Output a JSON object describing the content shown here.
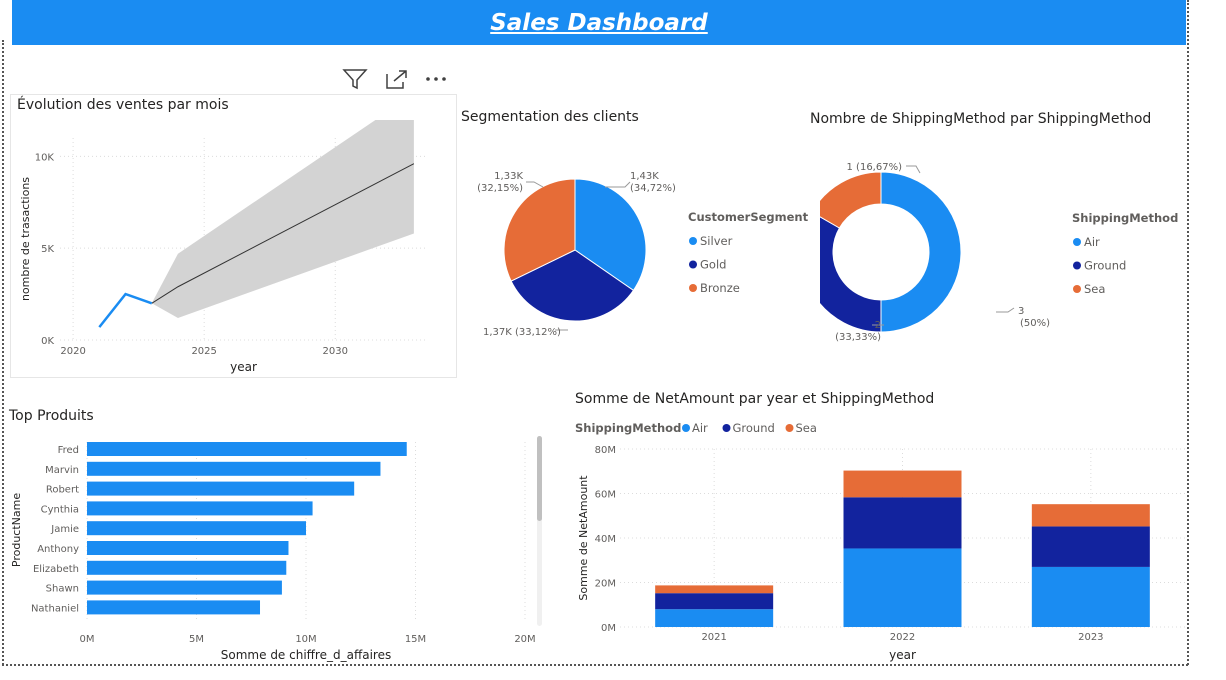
{
  "header": {
    "title": "Sales Dashboard"
  },
  "visual_header": {
    "icons": [
      "filter-icon",
      "focus-mode-icon",
      "more-options-icon"
    ]
  },
  "colors": {
    "primary": "#1a8cf2",
    "dark_blue": "#12239e",
    "orange": "#e66c37",
    "band": "#d3d3d3"
  },
  "chart_data": [
    {
      "id": "sales-evolution",
      "type": "line",
      "title": "Évolution des ventes par mois",
      "xlabel": "year",
      "ylabel": "nombre de trasactions",
      "x_ticks": [
        "2020",
        "2025",
        "2030"
      ],
      "y_ticks": [
        "0K",
        "5K",
        "10K"
      ],
      "xlim": [
        2019.5,
        2033.5
      ],
      "ylim": [
        0,
        11000
      ],
      "grid": true,
      "series": [
        {
          "kind": "actual",
          "x": [
            2021,
            2022,
            2023
          ],
          "y": [
            700,
            2500,
            2000
          ]
        },
        {
          "kind": "forecast",
          "x": [
            2023,
            2024,
            2033
          ],
          "y": [
            2000,
            2900,
            9600
          ]
        },
        {
          "kind": "confidence-band",
          "x": [
            2023,
            2024,
            2033
          ],
          "upper": [
            2000,
            4700,
            13400
          ],
          "lower": [
            2000,
            1200,
            5800
          ]
        }
      ]
    },
    {
      "id": "customer-segmentation",
      "type": "pie",
      "title": "Segmentation des clients",
      "legend_title": "CustomerSegment",
      "legend_position": "right",
      "slices": [
        {
          "label": "Silver",
          "value": 1430,
          "percent": 34.72,
          "display": "1,43K",
          "percent_display": "(34,72%)",
          "color": "#1a8cf2"
        },
        {
          "label": "Gold",
          "value": 1370,
          "percent": 33.12,
          "display": "1,37K (33,12%)",
          "color": "#12239e"
        },
        {
          "label": "Bronze",
          "value": 1330,
          "percent": 32.15,
          "display": "1,33K",
          "percent_display": "(32,15%)",
          "color": "#e66c37"
        }
      ]
    },
    {
      "id": "shipping-count",
      "type": "pie",
      "subtype": "donut",
      "title": "Nombre de ShippingMethod par ShippingMethod",
      "legend_title": "ShippingMethod",
      "legend_position": "right",
      "slices": [
        {
          "label": "Air",
          "value": 3,
          "percent": 50,
          "display": "3",
          "percent_display": "(50%)",
          "color": "#1a8cf2"
        },
        {
          "label": "Ground",
          "value": 2,
          "percent": 33.33,
          "display": "2",
          "percent_display": "(33,33%)",
          "color": "#12239e"
        },
        {
          "label": "Sea",
          "value": 1,
          "percent": 16.67,
          "display": "1 (16,67%)",
          "color": "#e66c37"
        }
      ]
    },
    {
      "id": "top-products",
      "type": "bar",
      "orientation": "horizontal",
      "title": "Top Produits",
      "xlabel": "Somme de chiffre_d_affaires",
      "ylabel": "ProductName",
      "x_ticks": [
        "0M",
        "5M",
        "10M",
        "15M",
        "20M"
      ],
      "xlim": [
        0,
        20000000
      ],
      "categories": [
        "Fred",
        "Marvin",
        "Robert",
        "Cynthia",
        "Jamie",
        "Anthony",
        "Elizabeth",
        "Shawn",
        "Nathaniel"
      ],
      "values": [
        14600000,
        13400000,
        12200000,
        10300000,
        10000000,
        9200000,
        9100000,
        8900000,
        7900000
      ]
    },
    {
      "id": "netamount-by-year",
      "type": "bar",
      "stacked": true,
      "title": "Somme de NetAmount par year et ShippingMethod",
      "legend_title": "ShippingMethod",
      "legend_position": "top-left",
      "xlabel": "year",
      "ylabel": "Somme de NetAmount",
      "y_ticks": [
        "0M",
        "20M",
        "40M",
        "60M",
        "80M"
      ],
      "ylim": [
        0,
        80000000
      ],
      "categories": [
        "2021",
        "2022",
        "2023"
      ],
      "series": [
        {
          "name": "Air",
          "color": "#1a8cf2",
          "values": [
            8000000,
            35300000,
            27000000
          ]
        },
        {
          "name": "Ground",
          "color": "#12239e",
          "values": [
            7200000,
            23000000,
            18200000
          ]
        },
        {
          "name": "Sea",
          "color": "#e66c37",
          "values": [
            3500000,
            12000000,
            10000000
          ]
        }
      ]
    }
  ]
}
